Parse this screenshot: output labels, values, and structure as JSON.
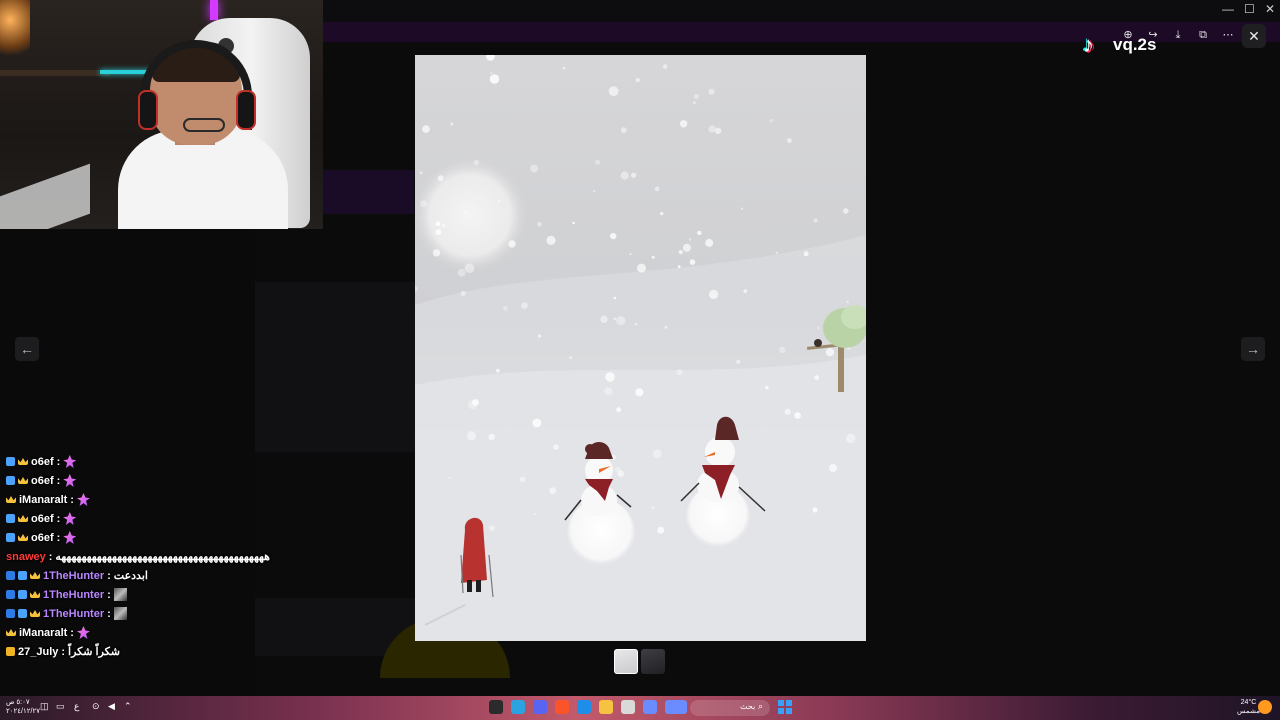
{
  "viewer": {
    "watermark_text": "vq.2s",
    "watermark_logo": "tiktok-logo",
    "photo_count": 2,
    "tools": [
      "zoom-in-icon",
      "share-icon",
      "download-icon",
      "open-external-icon",
      "more-icon"
    ],
    "close_label": "✕",
    "prev_label": "←",
    "next_label": "→"
  },
  "chat": {
    "messages": [
      {
        "user": "o6ef",
        "user_color": "#ffffff",
        "badges": [
          "b-blue",
          "b-crown"
        ],
        "text": "",
        "emote": "emote-pink"
      },
      {
        "user": "o6ef",
        "user_color": "#ffffff",
        "badges": [
          "b-blue",
          "b-crown"
        ],
        "text": "",
        "emote": "emote-pink"
      },
      {
        "user": "iManaralt",
        "user_color": "#ffffff",
        "badges": [
          "b-crown"
        ],
        "text": "",
        "emote": "emote-pink"
      },
      {
        "user": "o6ef",
        "user_color": "#ffffff",
        "badges": [
          "b-blue",
          "b-crown"
        ],
        "text": "",
        "emote": "emote-pink"
      },
      {
        "user": "o6ef",
        "user_color": "#ffffff",
        "badges": [
          "b-blue",
          "b-crown"
        ],
        "text": "",
        "emote": "emote-pink"
      },
      {
        "user": "snawey",
        "user_color": "#ff3b3b",
        "badges": [],
        "text": "هههههههههههههههههههههههههههههههههههههههههه",
        "emote": ""
      },
      {
        "user": "1TheHunter",
        "user_color": "#b987ff",
        "badges": [
          "b-sub",
          "b-blue",
          "b-crown"
        ],
        "text": "ابددعت",
        "emote": ""
      },
      {
        "user": "1TheHunter",
        "user_color": "#b987ff",
        "badges": [
          "b-sub",
          "b-blue",
          "b-crown"
        ],
        "text": "",
        "emote": "emote-img"
      },
      {
        "user": "1TheHunter",
        "user_color": "#b987ff",
        "badges": [
          "b-sub",
          "b-blue",
          "b-crown"
        ],
        "text": "",
        "emote": "emote-img"
      },
      {
        "user": "iManaralt",
        "user_color": "#ffffff",
        "badges": [
          "b-crown"
        ],
        "text": "",
        "emote": "emote-pink"
      },
      {
        "user": "27_July",
        "user_color": "#ffffff",
        "badges": [
          "b-gold"
        ],
        "text": "شكراً شكراً",
        "emote": ""
      }
    ]
  },
  "taskbar": {
    "time": "٥:٠٧ ص",
    "date": "٢٠٢٤/١٢/٢٧",
    "search_label": "بحث",
    "weather_temp": "24°C",
    "weather_desc": "مشمس",
    "apps": [
      {
        "name": "obs-icon",
        "color": "#2b2b2b"
      },
      {
        "name": "telegram-icon",
        "color": "#2aa3e0"
      },
      {
        "name": "discord-icon",
        "color": "#5865f2"
      },
      {
        "name": "brave-icon",
        "color": "#fb542b"
      },
      {
        "name": "edge-icon",
        "color": "#1e8ee8"
      },
      {
        "name": "folder-icon",
        "color": "#f5c242"
      },
      {
        "name": "notepad-icon",
        "color": "#d9d9d9"
      },
      {
        "name": "media-icon",
        "color": "#6b8cff"
      }
    ]
  }
}
